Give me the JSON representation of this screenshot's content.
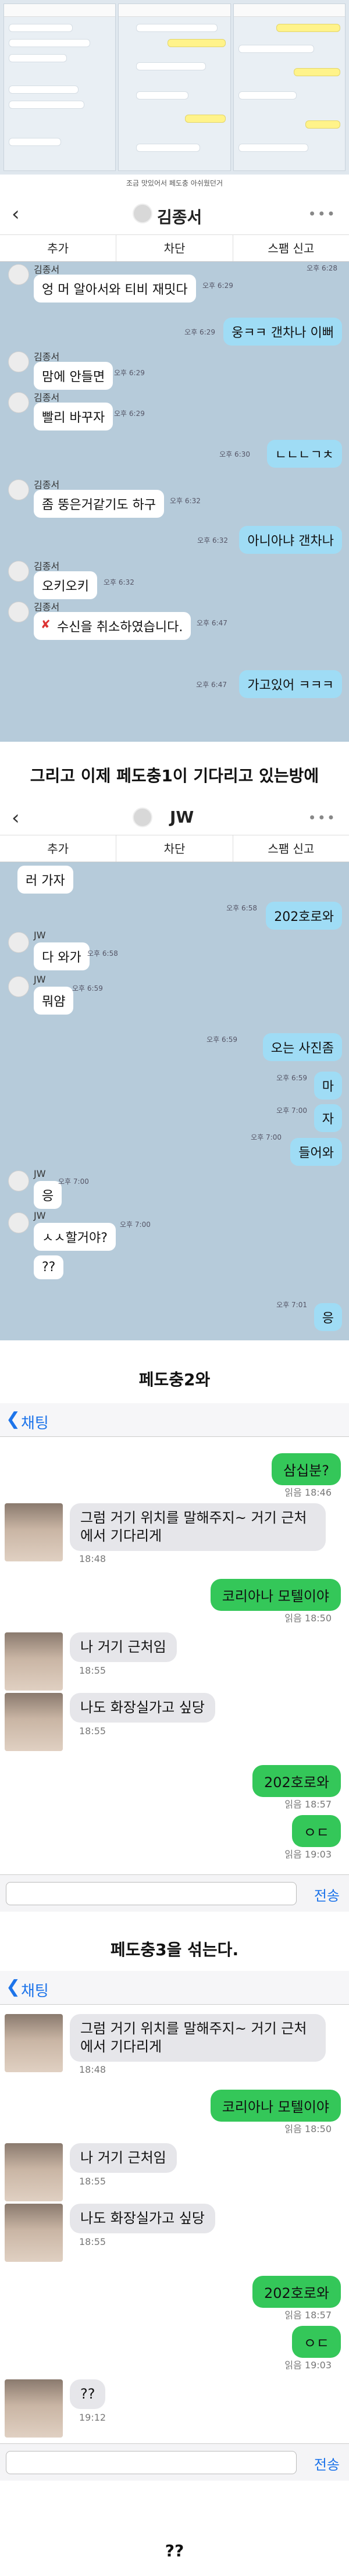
{
  "top_caption": "조금 맛있어서 페도충 아쉬웠던거",
  "chat1": {
    "contact_name": "김종서",
    "actions": [
      "추가",
      "차단",
      "스팸 신고"
    ],
    "messages": [
      {
        "from": "them",
        "sender": "",
        "text": "",
        "time": "오후 6:28"
      },
      {
        "from": "them",
        "sender": "김종서",
        "text": "엉 머 알아서와 티비 재밋다",
        "time": "오후 6:29"
      },
      {
        "from": "me",
        "text": "웅ㅋㅋ 갠차나 이뻐",
        "time": "오후 6:29"
      },
      {
        "from": "them",
        "sender": "김종서",
        "text": "맘에 안들면",
        "time": "오후 6:29"
      },
      {
        "from": "them",
        "sender": "김종서",
        "text": "빨리 바꾸자",
        "time": "오후 6:29"
      },
      {
        "from": "me",
        "text": "ㄴㄴㄴㄱㅊ",
        "time": "오후 6:30"
      },
      {
        "from": "them",
        "sender": "김종서",
        "text": "좀 뚱은거같기도 하구",
        "time": "오후 6:32"
      },
      {
        "from": "me",
        "text": "아니아냐 갠차나",
        "time": "오후 6:32"
      },
      {
        "from": "them",
        "sender": "김종서",
        "text": "오키오키",
        "time": "오후 6:32"
      },
      {
        "from": "them",
        "sender": "김종서",
        "text": "수신을 취소하였습니다.",
        "time": "오후 6:47"
      },
      {
        "from": "me",
        "text": "가고있어 ㅋㅋㅋ",
        "time": "오후 6:47"
      }
    ]
  },
  "caption2": "그리고 이제 페도충1이 기다리고 있는방에",
  "chat2": {
    "contact_name": "JW",
    "actions": [
      "추가",
      "차단",
      "스팸 신고"
    ],
    "messages": [
      {
        "from": "them",
        "sender": "",
        "text": "러 가자",
        "time": ""
      },
      {
        "from": "me",
        "text": "202호로와",
        "time": "오후 6:58"
      },
      {
        "from": "them",
        "sender": "JW",
        "text": "다 와가",
        "time": "오후 6:58"
      },
      {
        "from": "them",
        "sender": "JW",
        "text": "뭐얌",
        "time": "오후 6:59"
      },
      {
        "from": "me",
        "text": "오는 사진좀",
        "time": "오후 6:59"
      },
      {
        "from": "me",
        "text": "마",
        "time": "오후 6:59"
      },
      {
        "from": "me",
        "text": "자",
        "time": "오후 7:00"
      },
      {
        "from": "me",
        "text": "들어와",
        "time": "오후 7:00"
      },
      {
        "from": "them",
        "sender": "JW",
        "text": "응",
        "time": "오후 7:00"
      },
      {
        "from": "them",
        "sender": "JW",
        "text": "ㅅㅅ할거야?",
        "time": "오후 7:00"
      },
      {
        "from": "them",
        "sender": "",
        "text": "??",
        "time": ""
      },
      {
        "from": "me",
        "text": "응",
        "time": "오후 7:01"
      }
    ]
  },
  "caption3": "페도충2와",
  "chat3": {
    "back_label": "채팅",
    "messages": [
      {
        "from": "me",
        "text": "삼십분?",
        "time": "읽음 18:46"
      },
      {
        "from": "them",
        "text": "그럼 거기 위치를 말해주지~ 거기 근처에서 기다리게",
        "time": "18:48"
      },
      {
        "from": "me",
        "text": "코리아나 모텔이야",
        "time": "읽음 18:50"
      },
      {
        "from": "them",
        "text": "나 거기 근처임",
        "time": "18:55"
      },
      {
        "from": "them",
        "text": "나도 화장실가고 싶당",
        "time": "18:55"
      },
      {
        "from": "me",
        "text": "202호로와",
        "time": "읽음 18:57"
      },
      {
        "from": "me",
        "text": "ㅇㄷ",
        "time": "읽음 19:03"
      }
    ],
    "send_label": "전송"
  },
  "caption4": "페도충3을 섞는다.",
  "chat4": {
    "back_label": "채팅",
    "messages": [
      {
        "from": "them",
        "text": "그럼 거기 위치를 말해주지~ 거기 근처에서 기다리게",
        "time": "18:48"
      },
      {
        "from": "me",
        "text": "코리아나 모텔이야",
        "time": "읽음 18:50"
      },
      {
        "from": "them",
        "text": "나 거기 근처임",
        "time": "18:55"
      },
      {
        "from": "them",
        "text": "나도 화장실가고 싶당",
        "time": "18:55"
      },
      {
        "from": "me",
        "text": "202호로와",
        "time": "읽음 18:57"
      },
      {
        "from": "me",
        "text": "ㅇㄷ",
        "time": "읽음 19:03"
      },
      {
        "from": "them",
        "text": "??",
        "time": "19:12"
      }
    ],
    "send_label": "전송"
  },
  "footer_caption": "??",
  "icons": {
    "back": "back-chevron-icon",
    "more": "more-dots-icon",
    "avatar": "avatar-icon",
    "recall": "recall-x-icon"
  }
}
